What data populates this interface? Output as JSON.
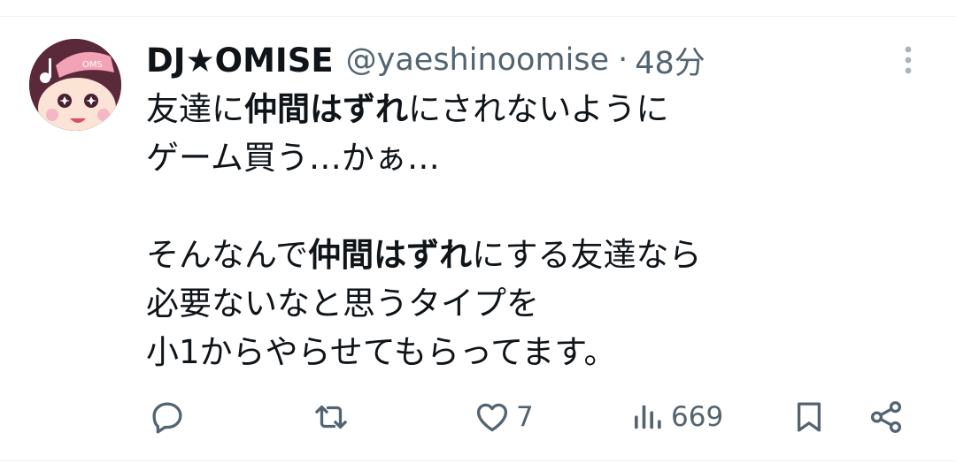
{
  "tweet": {
    "author": {
      "display_name": "DJ★OMISE",
      "handle": "@yaeshinoomise",
      "avatar_icon": "avatar-icon",
      "avatar_cap_text": "OMS"
    },
    "separator": "·",
    "timestamp": "48分",
    "text": {
      "line1": {
        "part1": "友達に",
        "bold": "仲間はずれ",
        "part2": "にされないように"
      },
      "line2": "ゲーム買う…かぁ…",
      "line3": {
        "part1": "そんなんで",
        "bold": "仲間はずれ",
        "part2": "にする友達なら"
      },
      "line4": "必要ないなと思うタイプを",
      "line5": "小1からやらせてもらってます。"
    },
    "actions": {
      "reply": {
        "icon": "reply-icon",
        "count": ""
      },
      "retweet": {
        "icon": "retweet-icon",
        "count": ""
      },
      "like": {
        "icon": "heart-icon",
        "count": "7"
      },
      "views": {
        "icon": "views-icon",
        "count": "669"
      },
      "bookmark": {
        "icon": "bookmark-icon"
      },
      "share": {
        "icon": "share-icon"
      }
    }
  },
  "colors": {
    "text_primary": "#0f1419",
    "text_secondary": "#536471",
    "divider": "#eff3f4"
  }
}
